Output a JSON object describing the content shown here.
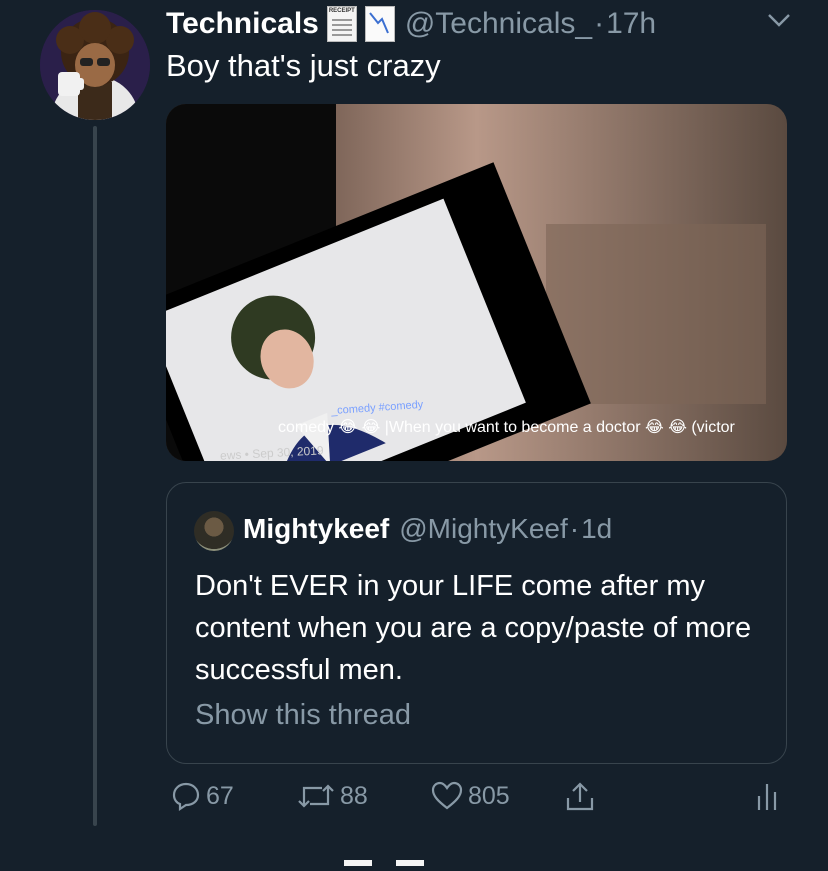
{
  "tweet": {
    "author_name": "Technicals",
    "author_handle": "@Technicals_",
    "separator": "·",
    "time": "17h",
    "text": "Boy that's just crazy",
    "name_emoji_1": "receipt-icon",
    "name_emoji_2": "chart-decreasing-icon",
    "receipt_label": "RECEIPT"
  },
  "media": {
    "caption_tags": "_comedy #comedy",
    "caption_line": "comedy 😂 😂 |When you want to become a doctor 😂 😂 (victor",
    "caption_meta": "ews • Sep 30, 2019"
  },
  "quote": {
    "author_name": "Mightykeef",
    "author_handle": "@MightyKeef",
    "separator": "·",
    "time": "1d",
    "text": "Don't EVER in your LIFE come after my content when you are a copy/paste of more successful men.",
    "show_thread": "Show this thread"
  },
  "actions": {
    "replies": "67",
    "retweets": "88",
    "likes": "805"
  },
  "colors": {
    "background": "#15202b",
    "muted": "#8899a6",
    "border": "#38444d"
  }
}
